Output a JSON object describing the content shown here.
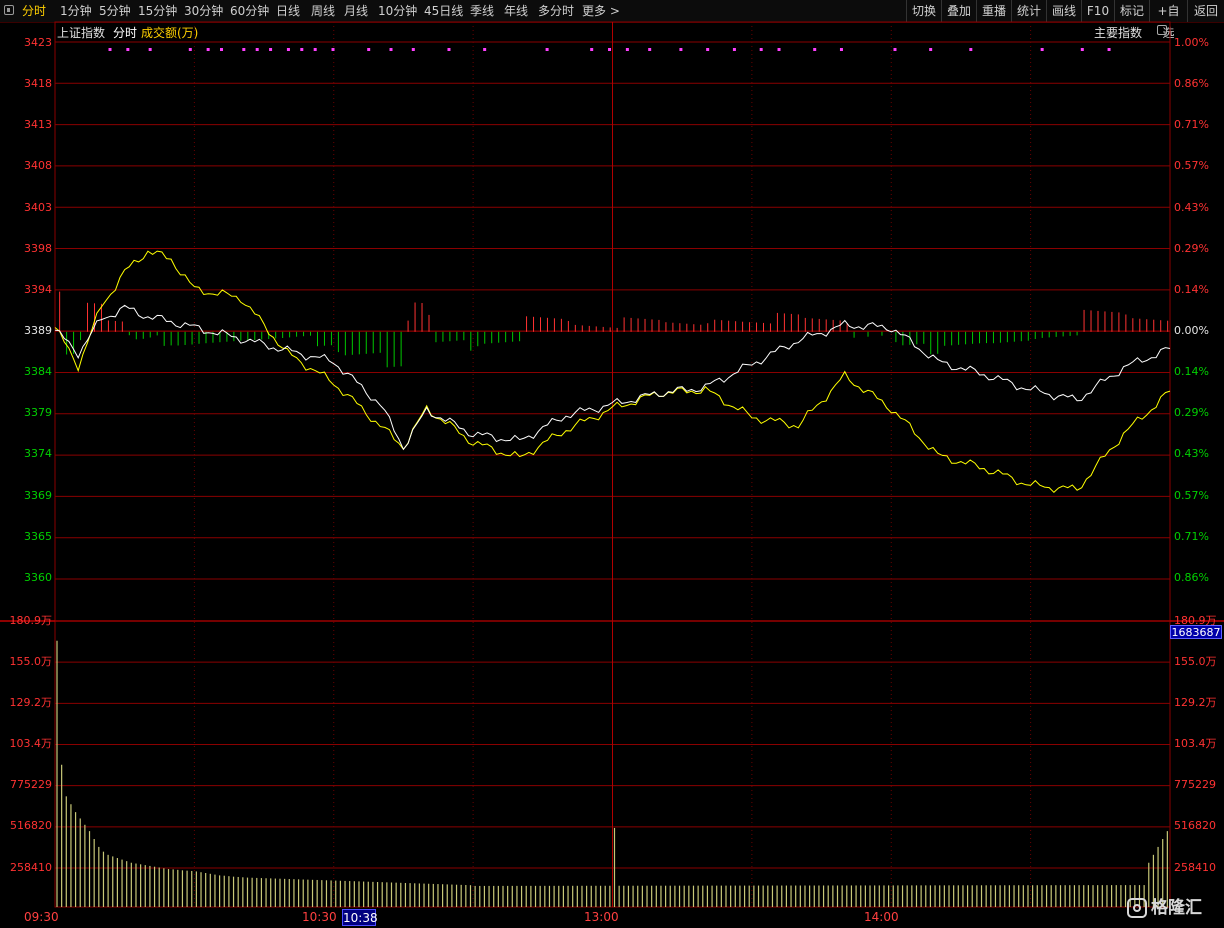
{
  "toolbar": {
    "periods": [
      "分时",
      "1分钟",
      "5分钟",
      "15分钟",
      "30分钟",
      "60分钟",
      "日线",
      "周线",
      "月线",
      "10分钟",
      "45日线",
      "季线",
      "年线",
      "多分时",
      "更多 >"
    ],
    "active_period": "分时",
    "actions": [
      "切换",
      "叠加",
      "重播",
      "统计",
      "画线",
      "F10",
      "标记",
      "+自选",
      "返回"
    ]
  },
  "header": {
    "index_name": "上证指数",
    "mode": "分时",
    "amount_label": "成交额(万)",
    "main_index_button": "主要指数"
  },
  "price_axis": {
    "left_labels": [
      "3423",
      "3418",
      "3413",
      "3408",
      "3403",
      "3398",
      "3394",
      "3389",
      "3384",
      "3379",
      "3374",
      "3369",
      "3365",
      "3360"
    ],
    "right_labels": [
      "1.00%",
      "0.86%",
      "0.71%",
      "0.57%",
      "0.43%",
      "0.29%",
      "0.14%",
      "0.00%",
      "0.14%",
      "0.29%",
      "0.43%",
      "0.57%",
      "0.71%",
      "0.86%"
    ],
    "base_index": 7
  },
  "volume_axis": {
    "left_labels": [
      "180.9万",
      "155.0万",
      "129.2万",
      "103.4万",
      "775229",
      "516820",
      "258410"
    ],
    "right_labels": [
      "180.9万",
      "155.0万",
      "129.2万",
      "103.4万",
      "775229",
      "516820",
      "258410"
    ],
    "current_volume": "1683687"
  },
  "time_axis": {
    "labels": [
      "09:30",
      "10:30",
      "13:00",
      "14:00"
    ],
    "cursor_time": "10:38"
  },
  "colors": {
    "grid": "#8a0000",
    "price_line": "#ffffff",
    "avg_line": "#ffff00",
    "up_bar": "#ff3232",
    "down_bar": "#00c800",
    "volume_bar": "#c8c878",
    "signal_dot": "#ff40ff"
  },
  "watermark": "格隆汇",
  "chart_data": {
    "type": "line",
    "x_minutes": [
      0,
      5,
      10,
      15,
      20,
      25,
      30,
      40,
      50,
      60,
      70,
      75,
      80,
      90,
      100,
      110,
      120,
      130,
      140,
      150,
      160,
      170,
      180,
      190,
      200,
      210,
      220,
      230,
      240
    ],
    "series": [
      {
        "values": [
          3389.2,
          3386.5,
          3390.5,
          3391.8,
          3390.8,
          3390.2,
          3389.5,
          3388.2,
          3386.8,
          3385.5,
          3380.5,
          3375.5,
          3379.8,
          3377.0,
          3376.2,
          3379.2,
          3380.5,
          3381.8,
          3382.5,
          3385.2,
          3388.0,
          3389.8,
          3389.5,
          3385.5,
          3384.0,
          3382.2,
          3381.0,
          3384.8,
          3387.0
        ]
      },
      {
        "values": [
          3389.5,
          3385.0,
          3392.0,
          3396.0,
          3398.5,
          3397.5,
          3394.0,
          3393.0,
          3386.5,
          3383.0,
          3378.0,
          3375.5,
          3380.0,
          3376.0,
          3374.2,
          3377.5,
          3380.0,
          3381.8,
          3382.2,
          3379.0,
          3378.0,
          3383.8,
          3380.0,
          3374.5,
          3373.0,
          3371.0,
          3370.5,
          3377.0,
          3382.0
        ]
      }
    ],
    "volume_bars": [
      1683687,
      900000,
      700000,
      650000,
      600000,
      560000,
      520000,
      480000,
      430000,
      380000,
      350000,
      330000,
      320000,
      310000,
      300000,
      290000,
      280000,
      275000,
      270000,
      265000,
      260000,
      255000,
      250000,
      245000,
      240000,
      238000,
      235000,
      232000,
      230000,
      228000,
      225000,
      220000,
      215000,
      210000,
      205000,
      200000,
      198000,
      195000,
      192000,
      190000,
      188000,
      186000,
      185000,
      184000,
      183000,
      182000,
      181000,
      180000,
      179000,
      178000,
      177000,
      176000,
      175000,
      174000,
      173000,
      172000,
      171000,
      170000,
      169000,
      168000,
      167000,
      166000,
      165000,
      164000,
      163000,
      162000,
      161000,
      160000,
      159000,
      158000,
      157000,
      156000,
      155000,
      154000,
      153000,
      152000,
      151000,
      150000,
      149000,
      148000,
      147000,
      146000,
      145000,
      144000,
      143000,
      142000,
      141000,
      140000,
      139000,
      138000
    ],
    "ylim": [
      3360,
      3423
    ],
    "volume_ylim": [
      0,
      1809000
    ]
  }
}
